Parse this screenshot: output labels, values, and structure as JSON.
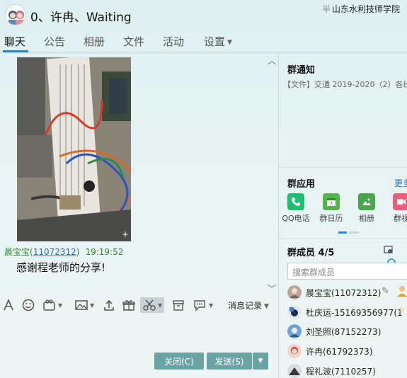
{
  "window": {
    "title": "0、许冉、Waiting",
    "school_prefix": "半",
    "school": "山东水利技师学院"
  },
  "tabs": [
    {
      "label": "聊天",
      "active": true
    },
    {
      "label": "公告"
    },
    {
      "label": "相册"
    },
    {
      "label": "文件"
    },
    {
      "label": "活动"
    },
    {
      "label": "设置"
    }
  ],
  "chat": {
    "sender_name": "晨宝宝",
    "sender_id": "11072312",
    "time": "19:19:52",
    "message": "感谢程老师的分享!"
  },
  "toolbar": {
    "history_label": "消息记录"
  },
  "buttons": {
    "close_label": "关闭(C)",
    "send_label": "发送(S)"
  },
  "notice": {
    "title": "群通知",
    "text": "【文件】交通 2019-2020（2）各班"
  },
  "apps": {
    "title": "群应用",
    "more": "更多",
    "items": [
      {
        "label": "QQ电话",
        "color": "#1dbf73"
      },
      {
        "label": "群日历",
        "color": "#56b548"
      },
      {
        "label": "相册",
        "color": "#4aa54f"
      },
      {
        "label": "群视",
        "color": "#f25b7c"
      }
    ]
  },
  "members": {
    "title": "群成员 4/5",
    "search_placeholder": "搜索群成员",
    "list": [
      {
        "name": "晨宝宝(11072312)"
      },
      {
        "name": "杜庆运-15169356977(1"
      },
      {
        "name": "刘圣照(87152273)"
      },
      {
        "name": "许冉(61792373)"
      },
      {
        "name": "程礼波(7110257)"
      }
    ]
  }
}
